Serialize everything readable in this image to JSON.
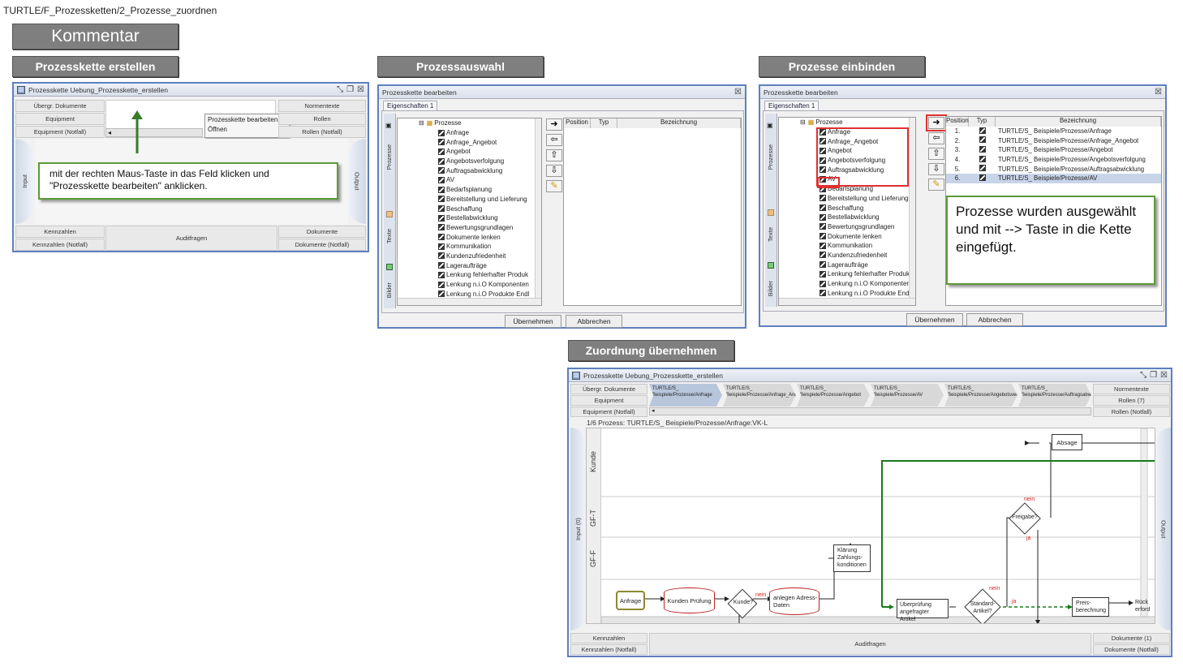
{
  "breadcrumb": "TURTLE/F_Prozessketten/2_Prozesse_zuordnen",
  "kommentar": "Kommentar",
  "headers": {
    "erstellen": "Prozesskette erstellen",
    "auswahl": "Prozessauswahl",
    "einbinden": "Prozesse einbinden",
    "uebernehmen": "Zuordnung übernehmen"
  },
  "win1": {
    "title": "Prozesskette Uebung_Prozesskette_erstellen",
    "left_cells": [
      "Übergr. Dokumente",
      "Equipment",
      "Equipment (Notfall)"
    ],
    "right_cells": [
      "Normentexte",
      "Rollen",
      "Rollen (Notfall)"
    ],
    "menu": [
      "Prozesskette bearbeiten...",
      "Öffnen"
    ],
    "input_label": "Input",
    "output_label": "Output",
    "bottom_left": [
      "Kennzahlen",
      "Kennzahlen (Notfall)"
    ],
    "bottom_mid": "Auditfragen",
    "bottom_right": [
      "Dokumente",
      "Dokumente (Notfall)"
    ],
    "callout": "mit der rechten Maus-Taste in das Feld klicken und \"Prozesskette bearbeiten\" anklicken."
  },
  "dialog": {
    "title": "Prozesskette bearbeiten",
    "tab": "Eigenschaften 1",
    "side_tabs": [
      "Prozesse",
      "Texte",
      "Bilder"
    ],
    "root": "Prozesse",
    "items": [
      "Anfrage",
      "Anfrage_Angebot",
      "Angebot",
      "Angebotsverfolgung",
      "Auftragsabwicklung",
      "AV",
      "Bedarfsplanung",
      "Bereitstellung und Lieferung",
      "Beschaffung",
      "Bestellabwicklung",
      "Bewertungsgrundlagen",
      "Dokumente lenken",
      "Kommunikation",
      "Kundenzufriedenheit",
      "Lageraufträge",
      "Lenkung fehlerhafter Produk",
      "Lenkung n.i.O Komponenten",
      "Lenkung n.i.O Produkte Endl"
    ],
    "col_position": "Position",
    "col_typ": "Typ",
    "col_bezeichnung": "Bezeichnung",
    "ok": "Übernehmen",
    "cancel": "Abbrechen"
  },
  "dialog2": {
    "rows": [
      {
        "pos": "1.",
        "bez": "TURTLE/S_ Beispiele/Prozesse/Anfrage"
      },
      {
        "pos": "2.",
        "bez": "TURTLE/S_ Beispiele/Prozesse/Anfrage_Angebot"
      },
      {
        "pos": "3.",
        "bez": "TURTLE/S_ Beispiele/Prozesse/Angebot"
      },
      {
        "pos": "4.",
        "bez": "TURTLE/S_ Beispiele/Prozesse/Angebotsverfolgung"
      },
      {
        "pos": "5.",
        "bez": "TURTLE/S_ Beispiele/Prozesse/Auftragsabwicklung"
      },
      {
        "pos": "6.",
        "bez": "TURTLE/S_ Beispiele/Prozesse/AV"
      }
    ],
    "callout": "Prozesse wurden ausgewählt und mit --> Taste in die Kette eingefügt."
  },
  "win4": {
    "title": "Prozesskette Uebung_Prozesskette_erstellen",
    "left_cells": [
      "Übergr. Dokumente",
      "Equipment",
      "Equipment (Notfall)"
    ],
    "right_cells": [
      "Normentexte",
      "Rollen (7)",
      "Rollen (Notfall)"
    ],
    "chain_tabs": [
      {
        "l1": "TURTLE/S_",
        "l2": "Beispiele/Prozesse/Anfrage"
      },
      {
        "l1": "TURTLE/S_",
        "l2": "Beispiele/Prozesse/Anfrage_Angebot"
      },
      {
        "l1": "TURTLE/S_",
        "l2": "Beispiele/Prozesse/Angebot"
      },
      {
        "l1": "TURTLE/S_",
        "l2": "Beispiele/Prozesse/AV"
      },
      {
        "l1": "TURTLE/S_",
        "l2": "Beispiele/Prozesse/Angebotsverfolgung"
      },
      {
        "l1": "TURTLE/S_",
        "l2": "Beispiele/Prozesse/Auftragsabwicklung"
      }
    ],
    "process_label": "1/6 Prozess: TURTLE/S_ Beispiele/Prozesse/Anfrage:VK-L",
    "lanes": [
      "Kunde",
      "GF-T",
      "GF-F"
    ],
    "input_label": "Input (0)",
    "output_label": "Output",
    "nodes": {
      "anfrage": "Anfrage",
      "kunden_pruefung": "Kunden Prüfung",
      "kunde_q": "Kunde?",
      "anlegen": "anlegen Adress-Daten",
      "klaerung": "Klärung Zahlungs-konditionen",
      "pruefung": "Überprüfung angefragter Artikel",
      "standard": "Standard-Artikel?",
      "preis": "Preis-berechnung",
      "rueck": "Rück erford",
      "freigabe": "Freigabe?",
      "absage": "Absage"
    },
    "edge_labels": {
      "nein": "nein",
      "ja": "ja"
    },
    "bottom_left": [
      "Kennzahlen",
      "Kennzahlen (Notfall)"
    ],
    "bottom_mid": "Auditfragen",
    "bottom_right": [
      "Dokumente (1)",
      "Dokumente (Notfall)"
    ]
  },
  "colors": {
    "header_bg": "#7f7f7f",
    "callout_border": "#5a9a3a",
    "highlight": "#e03030",
    "flow_green": "#1a7a1a"
  }
}
